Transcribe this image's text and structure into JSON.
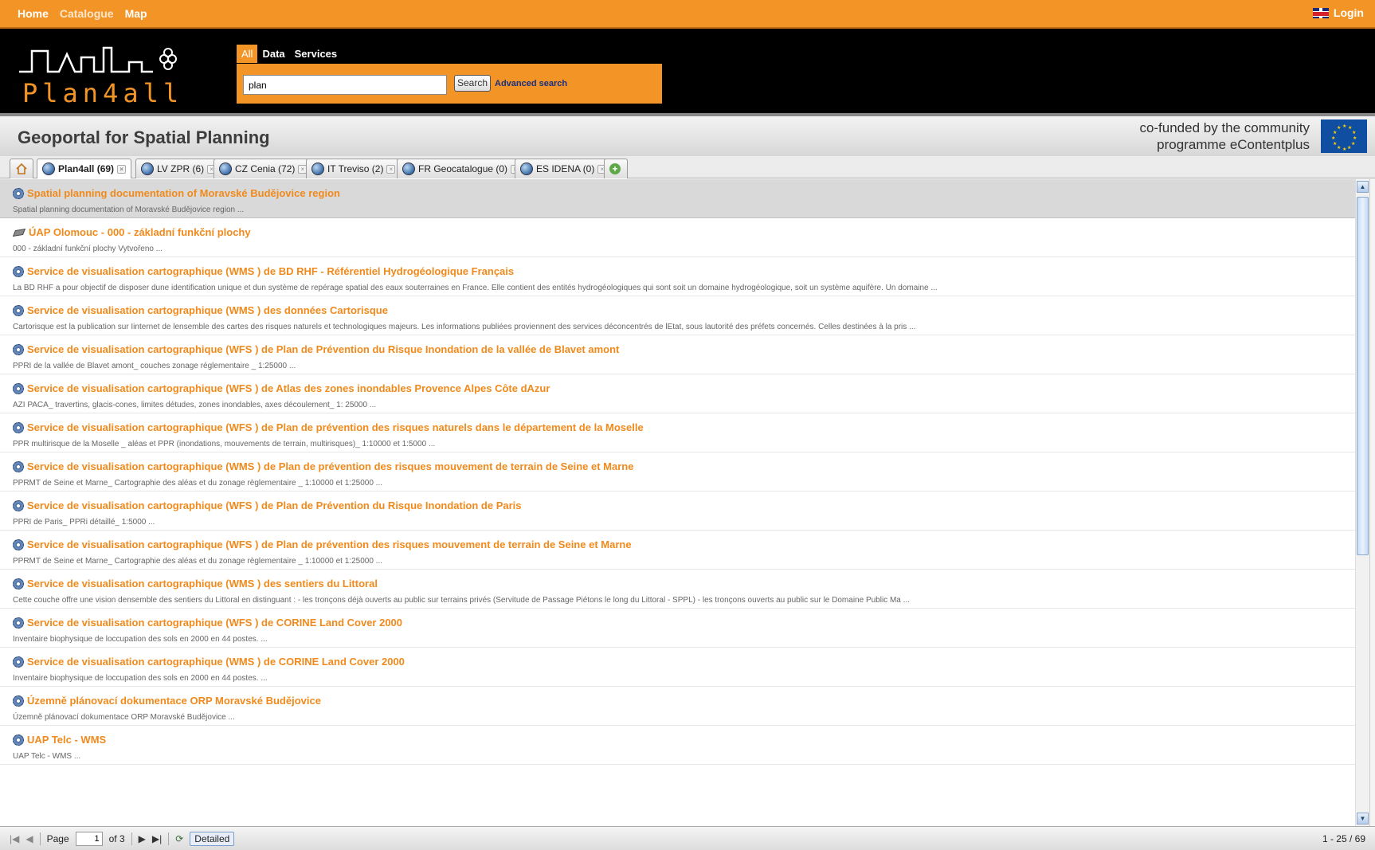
{
  "nav": {
    "home": "Home",
    "catalogue": "Catalogue",
    "map": "Map",
    "login": "Login"
  },
  "logo": {
    "text": "Plan4all"
  },
  "search": {
    "tabs": [
      "All",
      "Data",
      "Services"
    ],
    "query": "plan",
    "button": "Search",
    "advanced": "Advanced search"
  },
  "page": {
    "title": "Geoportal for Spatial Planning",
    "cofund_line1": "co-funded by the community",
    "cofund_line2": "programme eContentplus"
  },
  "tabs": [
    {
      "label": "Plan4all (69)"
    },
    {
      "label": "LV ZPR (6)"
    },
    {
      "label": "CZ Cenia (72)"
    },
    {
      "label": "IT Treviso (2)"
    },
    {
      "label": "FR Geocatalogue (0)"
    },
    {
      "label": "ES IDENA (0)"
    }
  ],
  "results": [
    {
      "title": "Spatial planning documentation of Moravské Budějovice region",
      "desc": "Spatial planning documentation of Moravské Budějovice region ...",
      "icon": "service-icon"
    },
    {
      "title": "ÚAP Olomouc - 000 - základní funkční plochy",
      "desc": "000 - základní funkční plochy Vytvořeno ...",
      "icon": "dataset-icon"
    },
    {
      "title": "Service de visualisation cartographique (WMS ) de BD RHF - Référentiel Hydrogéologique Français",
      "desc": "La BD RHF a pour objectif de disposer dune identification unique et dun système de repérage spatial des eaux souterraines en France. Elle contient des entités hydrogéologiques qui sont soit un domaine hydrogéologique, soit un système aquifère. Un domaine ...",
      "icon": "service-icon"
    },
    {
      "title": "Service de visualisation cartographique (WMS ) des données Cartorisque",
      "desc": "Cartorisque est la publication sur Iinternet de lensemble des cartes des risques naturels et technologiques majeurs. Les informations publiées proviennent des services déconcentrés de lEtat, sous lautorité des préfets concernés. Celles destinées à la pris ...",
      "icon": "service-icon"
    },
    {
      "title": "Service de visualisation cartographique (WFS ) de Plan de Prévention du Risque Inondation de la vallée de Blavet amont",
      "desc": "PPRI de la vallée de Blavet amont_ couches zonage réglementaire _ 1:25000 ...",
      "icon": "service-icon"
    },
    {
      "title": "Service de visualisation cartographique (WFS ) de Atlas des zones inondables Provence Alpes Côte dAzur",
      "desc": "AZI PACA_ travertins, glacis-cones, limites détudes, zones inondables, axes découlement_ 1: 25000 ...",
      "icon": "service-icon"
    },
    {
      "title": "Service de visualisation cartographique (WFS ) de Plan de prévention des risques naturels dans le département de la Moselle",
      "desc": "PPR multirisque de la Moselle _ aléas et PPR (inondations, mouvements de terrain, multirisques)_ 1:10000 et 1:5000 ...",
      "icon": "service-icon"
    },
    {
      "title": "Service de visualisation cartographique (WMS ) de Plan de prévention des risques mouvement de terrain de Seine et Marne",
      "desc": "PPRMT de Seine et Marne_ Cartographie des aléas et du zonage règlementaire _ 1:10000 et 1:25000 ...",
      "icon": "service-icon"
    },
    {
      "title": "Service de visualisation cartographique (WFS ) de Plan de Prévention du Risque Inondation de Paris",
      "desc": "PPRI de Paris_ PPRi détaillé_ 1:5000 ...",
      "icon": "service-icon"
    },
    {
      "title": "Service de visualisation cartographique (WFS ) de Plan de prévention des risques mouvement de terrain de Seine et Marne",
      "desc": "PPRMT de Seine et Marne_ Cartographie des aléas et du zonage règlementaire _ 1:10000 et 1:25000 ...",
      "icon": "service-icon"
    },
    {
      "title": "Service de visualisation cartographique (WMS ) des sentiers du Littoral",
      "desc": "Cette couche offre une vision densemble des sentiers du Littoral en distinguant : - les tronçons déjà ouverts au public sur terrains privés (Servitude de Passage Piétons le long du Littoral - SPPL) - les tronçons ouverts au public sur le Domaine Public Ma ...",
      "icon": "service-icon"
    },
    {
      "title": "Service de visualisation cartographique (WFS ) de CORINE Land Cover 2000",
      "desc": "Inventaire biophysique de loccupation des sols en 2000 en 44 postes. ...",
      "icon": "service-icon"
    },
    {
      "title": "Service de visualisation cartographique (WMS ) de CORINE Land Cover 2000",
      "desc": "Inventaire biophysique de loccupation des sols en 2000 en 44 postes. ...",
      "icon": "service-icon"
    },
    {
      "title": "Územně plánovací dokumentace ORP Moravské Budějovice",
      "desc": "Územně plánovací dokumentace ORP Moravské Budějovice ...",
      "icon": "service-icon"
    },
    {
      "title": "UAP Telc - WMS",
      "desc": "UAP Telc - WMS ...",
      "icon": "service-icon"
    }
  ],
  "pager": {
    "page_label": "Page",
    "page_value": "1",
    "of_label": "of 3",
    "detailed": "Detailed",
    "count": "1 - 25 / 69"
  },
  "colors": {
    "accent": "#f39426",
    "link": "#f08a1c",
    "header_bg": "#000000"
  }
}
